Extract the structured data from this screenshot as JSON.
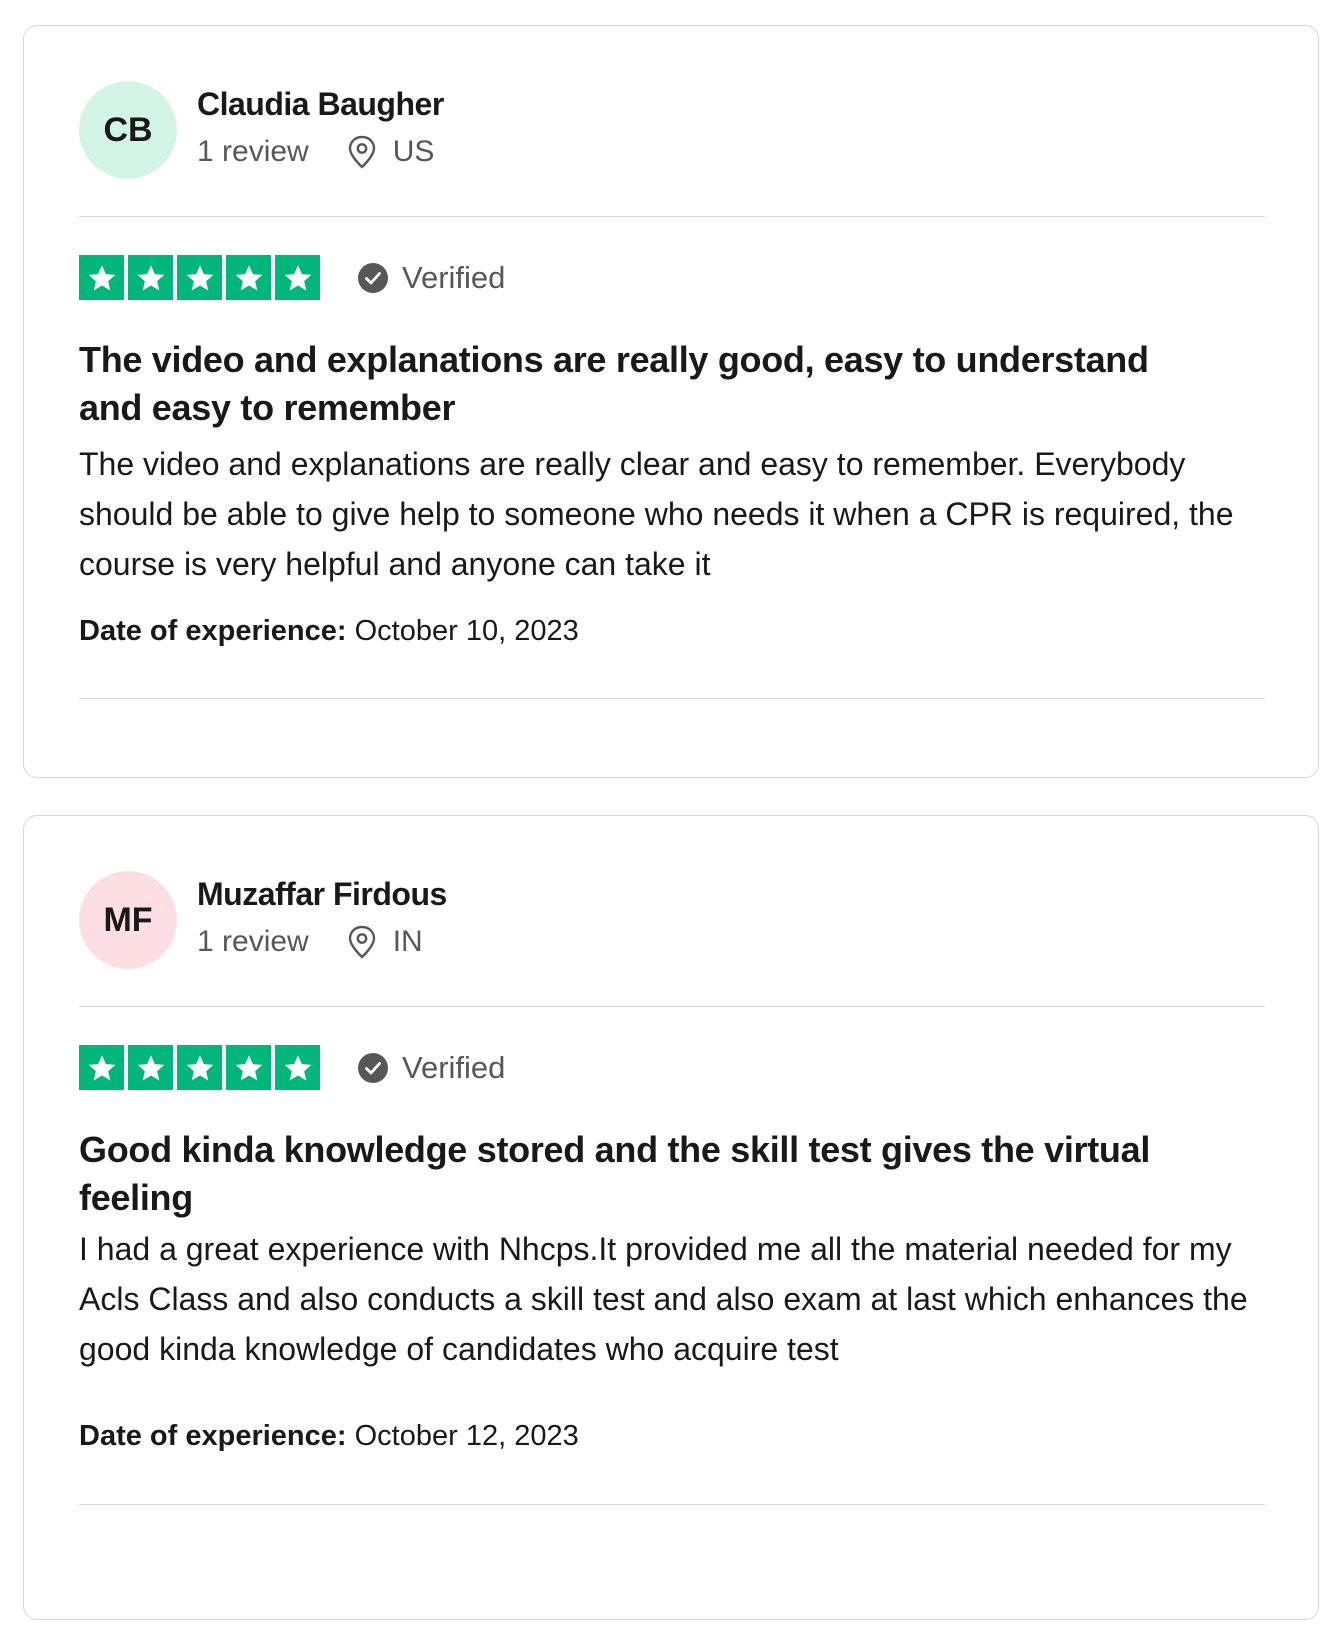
{
  "colors": {
    "star_green": "#00b67a",
    "avatar_cb_bg": "#d3f5e8",
    "avatar_mf_bg": "#fddfe3",
    "border": "#d6d6d6",
    "muted_text": "#575757"
  },
  "reviews": [
    {
      "initials": "CB",
      "name": "Claudia Baugher",
      "review_count": "1 review",
      "location_icon": "location-pin-icon",
      "location": "US",
      "rating": 5,
      "verified_label": "Verified",
      "title": "The video and explanations are really good, easy to understand and easy to remember",
      "body": "The video and explanations are really clear and easy to remember. Everybody should be able to give help to someone who needs it when a CPR is required, the course is very helpful and anyone can take it",
      "date_label": "Date of experience:",
      "date_value": "October 10, 2023"
    },
    {
      "initials": "MF",
      "name": "Muzaffar Firdous",
      "review_count": "1 review",
      "location_icon": "location-pin-icon",
      "location": "IN",
      "rating": 5,
      "verified_label": "Verified",
      "title": "Good kinda knowledge stored and the skill test gives the virtual feeling",
      "body": "I had a great experience with Nhcps.It provided me all the material needed for my Acls Class and also conducts a skill test and also exam at last which enhances the good kinda knowledge of candidates who acquire test",
      "date_label": "Date of experience:",
      "date_value": "October 12, 2023"
    }
  ]
}
